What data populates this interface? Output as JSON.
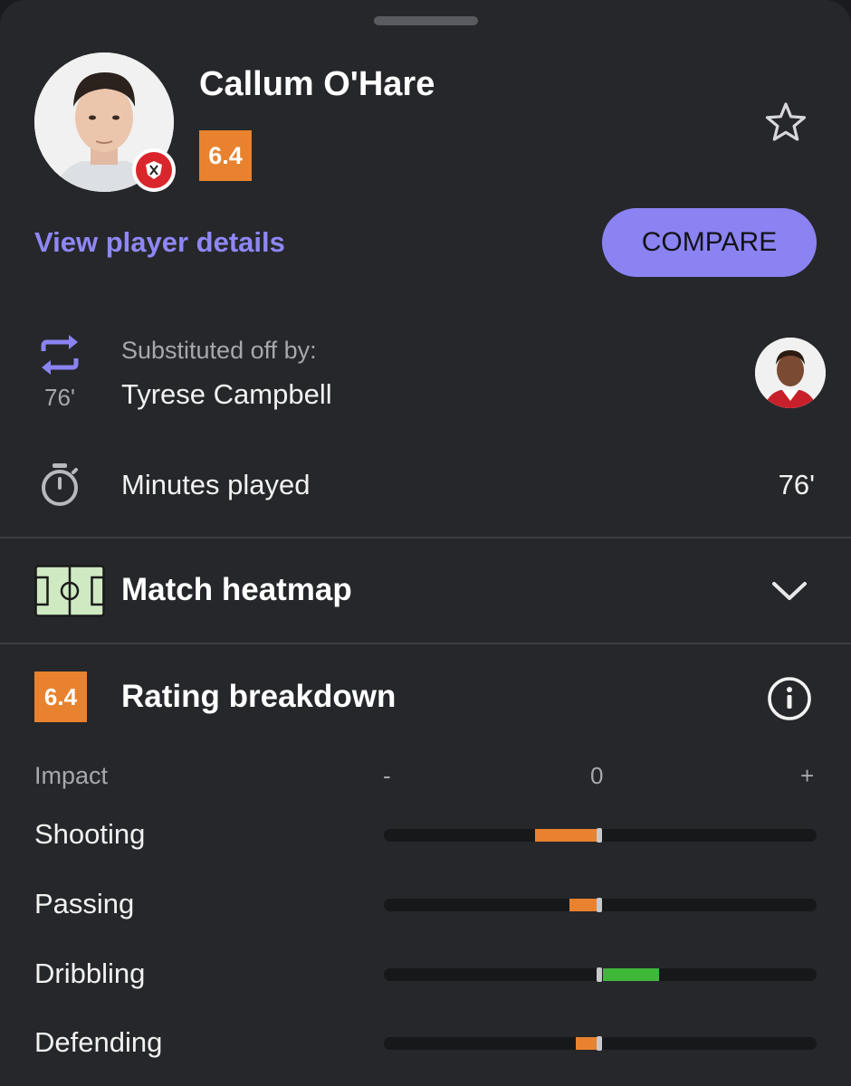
{
  "header": {
    "player_name": "Callum O'Hare",
    "rating": "6.4",
    "view_details_label": "View player details",
    "compare_label": "COMPARE",
    "star_icon": "star-outline-icon"
  },
  "substitution": {
    "label": "Substituted off by:",
    "player": "Tyrese Campbell",
    "minute": "76'",
    "icon": "substitution-arrows-icon"
  },
  "minutes": {
    "label": "Minutes played",
    "value": "76'",
    "icon": "stopwatch-icon"
  },
  "heatmap": {
    "title": "Match heatmap",
    "icon": "pitch-icon",
    "chevron": "chevron-down-icon"
  },
  "rating_breakdown": {
    "rating": "6.4",
    "title": "Rating breakdown",
    "info_icon": "info-icon",
    "impact_label": "Impact",
    "axis": {
      "minus": "-",
      "zero": "0",
      "plus": "+"
    },
    "metrics": [
      {
        "label": "Shooting",
        "value": -0.3,
        "color": "#e8822e"
      },
      {
        "label": "Passing",
        "value": -0.14,
        "color": "#e8822e"
      },
      {
        "label": "Dribbling",
        "value": 0.26,
        "color": "#3fb83a"
      },
      {
        "label": "Defending",
        "value": -0.11,
        "color": "#e8822e"
      }
    ]
  },
  "colors": {
    "accent": "#8b83f2",
    "rating": "#e8822e",
    "positive": "#3fb83a",
    "negative": "#e8822e",
    "background": "#26272b"
  }
}
